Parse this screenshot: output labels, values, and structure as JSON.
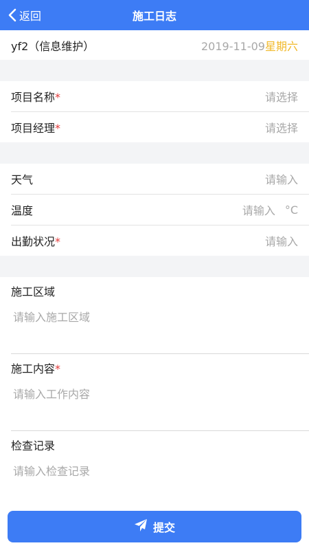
{
  "nav": {
    "back_label": "返回",
    "title": "施工日志",
    "icons": {
      "back": "chevron-left-icon"
    }
  },
  "header": {
    "user": "yf2（信息维护）",
    "date": "2019-11-09",
    "weekday": "星期六"
  },
  "project": {
    "name_label": "项目名称",
    "name_value": "请选择",
    "manager_label": "项目经理",
    "manager_value": "请选择"
  },
  "conditions": {
    "weather_label": "天气",
    "weather_placeholder": "请输入",
    "temp_label": "温度",
    "temp_placeholder": "请输入",
    "temp_unit": "°C",
    "attendance_label": "出勤状况",
    "attendance_placeholder": "请输入"
  },
  "details": {
    "area_label": "施工区域",
    "area_placeholder": "请输入施工区域",
    "content_label": "施工内容",
    "content_placeholder": "请输入工作内容",
    "inspection_label": "检查记录",
    "inspection_placeholder": "请输入检查记录"
  },
  "required_mark": "*",
  "submit": {
    "label": "提交",
    "icon": "paper-plane-icon"
  },
  "colors": {
    "primary": "#3d7cf5",
    "required": "#e23b3b",
    "weekday": "#f1b92a",
    "placeholder": "#a8a8a8",
    "section_bg": "#f3f4f6"
  }
}
